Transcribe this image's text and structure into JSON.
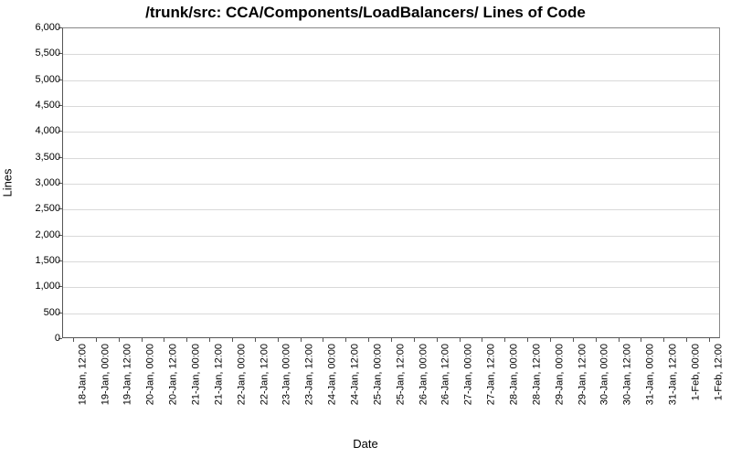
{
  "chart_data": {
    "type": "line",
    "title": "/trunk/src: CCA/Components/LoadBalancers/ Lines of Code",
    "xlabel": "Date",
    "ylabel": "Lines",
    "ylim": [
      0,
      6000
    ],
    "y_ticks": [
      0,
      500,
      1000,
      1500,
      2000,
      2500,
      3000,
      3500,
      4000,
      4500,
      5000,
      5500,
      6000
    ],
    "y_tick_labels": [
      "0",
      "500",
      "1,000",
      "1,500",
      "2,000",
      "2,500",
      "3,000",
      "3,500",
      "4,000",
      "4,500",
      "5,000",
      "5,500",
      "6,000"
    ],
    "categories": [
      "18-Jan, 12:00",
      "19-Jan, 00:00",
      "19-Jan, 12:00",
      "20-Jan, 00:00",
      "20-Jan, 12:00",
      "21-Jan, 00:00",
      "21-Jan, 12:00",
      "22-Jan, 00:00",
      "22-Jan, 12:00",
      "23-Jan, 00:00",
      "23-Jan, 12:00",
      "24-Jan, 00:00",
      "24-Jan, 12:00",
      "25-Jan, 00:00",
      "25-Jan, 12:00",
      "26-Jan, 00:00",
      "26-Jan, 12:00",
      "27-Jan, 00:00",
      "27-Jan, 12:00",
      "28-Jan, 00:00",
      "28-Jan, 12:00",
      "29-Jan, 00:00",
      "29-Jan, 12:00",
      "30-Jan, 00:00",
      "30-Jan, 12:00",
      "31-Jan, 00:00",
      "31-Jan, 12:00",
      "1-Feb, 00:00",
      "1-Feb, 12:00"
    ],
    "series": [
      {
        "name": "Lines",
        "values": []
      }
    ]
  }
}
